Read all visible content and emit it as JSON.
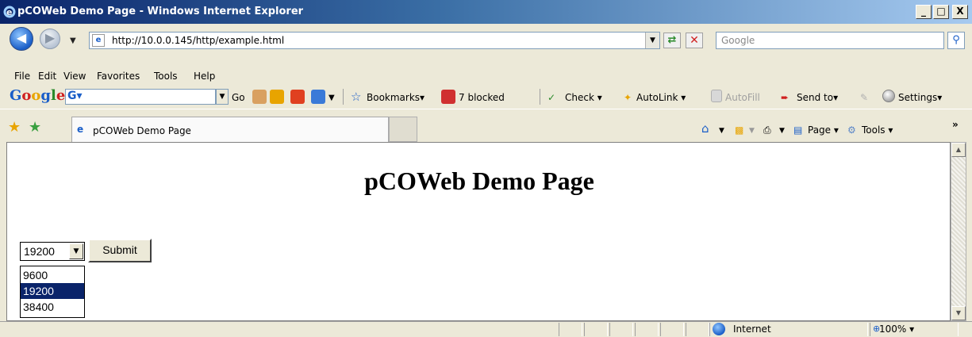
{
  "window": {
    "title": "pCOWeb Demo Page - Windows Internet Explorer",
    "min": "_",
    "max": "□",
    "close": "X"
  },
  "address_bar": {
    "url": "http://10.0.0.145/http/example.html",
    "search_placeholder": "Google"
  },
  "menu": [
    "File",
    "Edit",
    "View",
    "Favorites",
    "Tools",
    "Help"
  ],
  "google_toolbar": {
    "go": "Go",
    "bookmarks": "Bookmarks",
    "blocked": "7 blocked",
    "check": "Check",
    "autolink": "AutoLink",
    "autofill": "AutoFill",
    "send_to": "Send to",
    "settings": "Settings"
  },
  "tab": {
    "label": "pCOWeb Demo Page"
  },
  "command_bar": {
    "page": "Page",
    "tools": "Tools"
  },
  "page": {
    "heading": "pCOWeb Demo Page",
    "select_value": "19200",
    "submit_label": "Submit",
    "options": [
      "9600",
      "19200",
      "38400"
    ],
    "selected_option": "19200"
  },
  "status_bar": {
    "zone": "Internet",
    "zoom": "100%"
  }
}
